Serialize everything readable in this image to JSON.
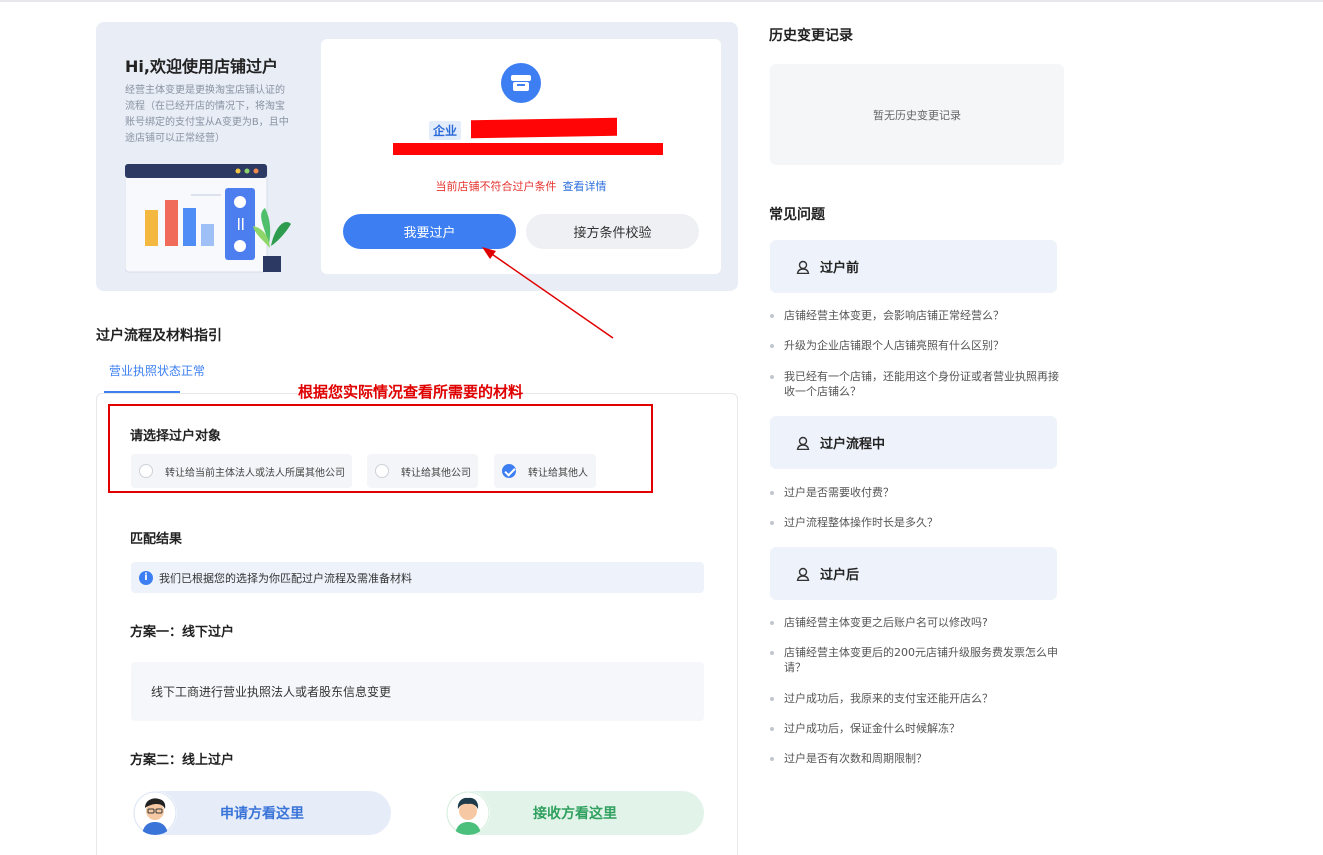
{
  "hero": {
    "title": "Hi,欢迎使用店铺过户",
    "description": "经营主体变更是更换淘宝店铺认证的流程（在已经开店的情况下，将淘宝账号绑定的支付宝从A变更为B，且中途店铺可以正常经营）",
    "store_tag": "企业",
    "condition_warning": "当前店铺不符合过户条件",
    "condition_link": "查看详情",
    "primary_button": "我要过户",
    "secondary_button": "接方条件校验"
  },
  "annotation": {
    "text": "根据您实际情况查看所需要的材料",
    "color": "#e00000"
  },
  "process": {
    "section_title": "过户流程及材料指引",
    "active_tab": "营业执照状态正常",
    "choose_title": "请选择过户对象",
    "options": [
      {
        "label": "转让给当前主体法人或法人所属其他公司",
        "checked": false
      },
      {
        "label": "转让给其他公司",
        "checked": false
      },
      {
        "label": "转让给其他人",
        "checked": true
      }
    ],
    "match_title": "匹配结果",
    "match_info": "我们已根据您的选择为你匹配过户流程及需准备材料",
    "plan1_title": "方案一：线下过户",
    "plan1_desc": "线下工商进行营业执照法人或者股东信息变更",
    "plan2_title": "方案二：线上过户",
    "apply_label": "申请方看这里",
    "receive_label": "接收方看这里"
  },
  "history": {
    "title": "历史变更记录",
    "empty": "暂无历史变更记录"
  },
  "faq": {
    "title": "常见问题",
    "groups": [
      {
        "name": "过户前",
        "items": [
          "店铺经营主体变更，会影响店铺正常经营么？",
          "升级为企业店铺跟个人店铺亮照有什么区别？",
          "我已经有一个店铺，还能用这个身份证或者营业执照再接收一个店铺么？"
        ]
      },
      {
        "name": "过户流程中",
        "items": [
          "过户是否需要收付费？",
          "过户流程整体操作时长是多久？"
        ]
      },
      {
        "name": "过户后",
        "items": [
          "店铺经营主体变更之后账户名可以修改吗?",
          "店铺经营主体变更后的200元店铺升级服务费发票怎么申请？",
          "过户成功后，我原来的支付宝还能开店么？",
          "过户成功后，保证金什么时候解冻？",
          "过户是否有次数和周期限制？"
        ]
      }
    ]
  },
  "colors": {
    "primary": "#3d7ff2",
    "warning": "#e5322d",
    "success": "#2fa05e"
  }
}
